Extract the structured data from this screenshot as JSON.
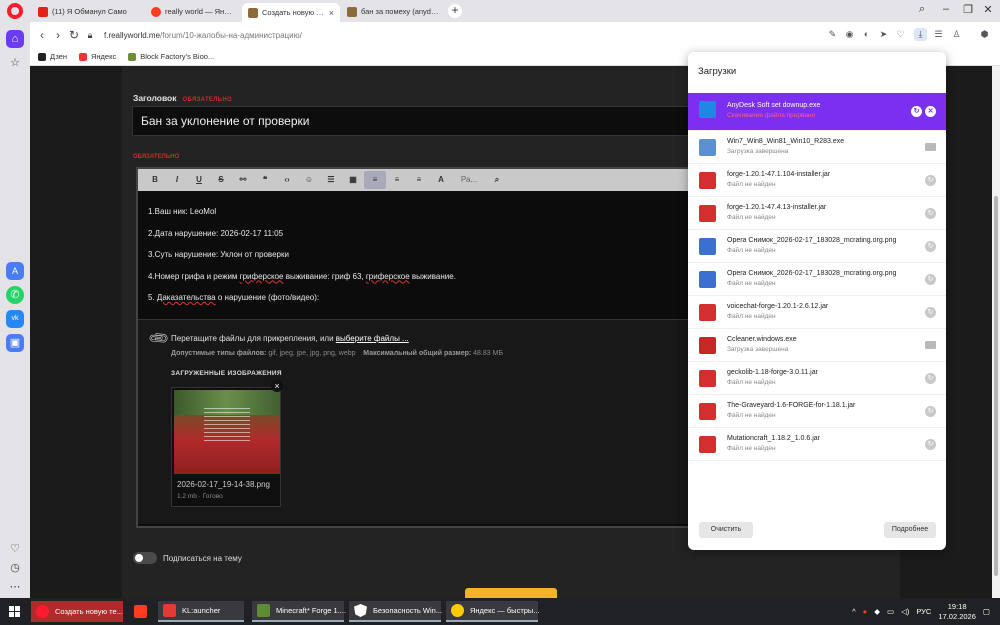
{
  "tabs": [
    {
      "title": "(11) Я Обманул Само",
      "active": false
    },
    {
      "title": "really world — Яндекс на",
      "active": false
    },
    {
      "title": "Создать новую тему - Re",
      "active": true
    },
    {
      "title": "бан за помеху (anydesk)",
      "active": false
    }
  ],
  "address": {
    "host": "f.reallyworld.me",
    "path": "/forum/10-жалобы-на-администрацию/"
  },
  "bookmarks": [
    "Дзен",
    "Яндекс",
    "Block Factory's Bioo..."
  ],
  "form": {
    "title_label": "Заголовок",
    "required": "ОБЯЗАТЕЛЬНО",
    "title_value": "Бан за уклонение от проверки",
    "toolbar_font": "Ра...",
    "body_lines": [
      "1.Ваш ник: LeoMol",
      "2.Дата нарушение:  2026-02-17 11:05",
      "3.Суть нарушение: Уклон от проверки",
      "4.Номер грифа и режим гриферское выживание: гриф 63, гриферское выживание.",
      "5. Даказательства о нарушение (фото/видео):"
    ],
    "drop_text": "Перетащите файлы для прикрепления, или",
    "drop_link": "выберите файлы ...",
    "allowed_label": "Допустимые типы файлов:",
    "allowed_types": "gif, jpeg, jpe, jpg, png, webp",
    "max_size_label": "Максимальный общий размер:",
    "max_size": "48.83 МБ",
    "uploaded_label": "ЗАГРУЖЕННЫЕ ИЗОБРАЖЕНИЯ",
    "upload_name": "2026-02-17_19-14-38.png",
    "upload_meta": "1.2 mb · Готово",
    "subscribe_label": "Подписаться на тему"
  },
  "downloads": {
    "title": "Загрузки",
    "items": [
      {
        "name": "AnyDesk Soft set downup.exe",
        "status": "Скачивание файла прервано",
        "icon_color": "#1e88e5",
        "action": "controls"
      },
      {
        "name": "Win7_Win8_Win81_Win10_R283.exe",
        "status": "Загрузка завершена",
        "icon_color": "#5b8fd6",
        "action": "folder"
      },
      {
        "name": "forge-1.20.1-47.1.104-installer.jar",
        "status": "Файл не найден",
        "icon_color": "#d32f2f",
        "action": "retry"
      },
      {
        "name": "forge-1.20.1-47.4.13-installer.jar",
        "status": "Файл не найден",
        "icon_color": "#d32f2f",
        "action": "retry"
      },
      {
        "name": "Opera Снимок_2026-02-17_183028_mcrating.org.png",
        "status": "Файл не найден",
        "icon_color": "#3b6fd1",
        "action": "retry"
      },
      {
        "name": "Opera Снимок_2026-02-17_183028_mcrating.org.png",
        "status": "Файл не найден",
        "icon_color": "#3b6fd1",
        "action": "retry"
      },
      {
        "name": "voicechat-forge-1.20.1-2.6.12.jar",
        "status": "Файл не найден",
        "icon_color": "#d32f2f",
        "action": "retry"
      },
      {
        "name": "Ccleaner.windows.exe",
        "status": "Загрузка завершена",
        "icon_color": "#c62828",
        "action": "folder"
      },
      {
        "name": "geckolib-1.18-forge-3.0.11.jar",
        "status": "Файл не найден",
        "icon_color": "#d32f2f",
        "action": "retry"
      },
      {
        "name": "The-Graveyard-1.6-FORGE-for-1.18.1.jar",
        "status": "Файл не найден",
        "icon_color": "#d32f2f",
        "action": "retry"
      },
      {
        "name": "Mutationcraft_1.18.2_1.0.6.jar",
        "status": "Файл не найден",
        "icon_color": "#d32f2f",
        "action": "retry"
      }
    ],
    "clear_label": "Очистить",
    "more_label": "Подробнее"
  },
  "taskbar": {
    "items": [
      "Создать новую те...",
      "",
      "KL:auncher",
      "Minecraft* Forge 1....",
      "Безопасность Win...",
      "Яндекс — быстры..."
    ],
    "lang": "РУС",
    "time": "19:18",
    "date": "17.02.2026"
  },
  "colors": {
    "accent": "#7b2ff0",
    "required": "#c0312b",
    "submit": "#f0b429",
    "opera": "#ff1b2d"
  }
}
